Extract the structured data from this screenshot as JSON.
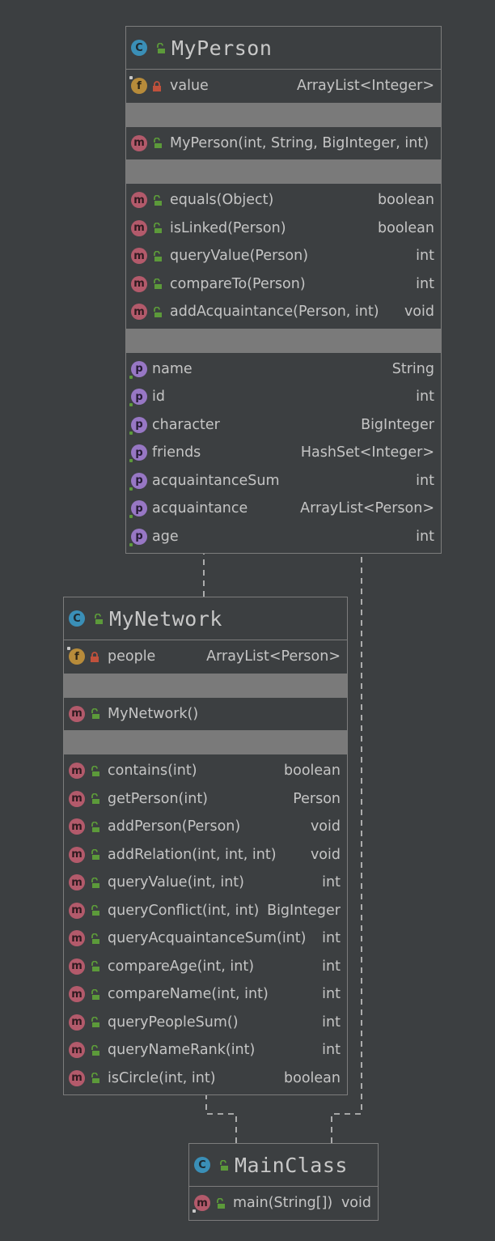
{
  "colors": {
    "background": "#3c3f41",
    "border": "#7c7c7c",
    "gap": "#7a7a7a",
    "text": "#c5c5c5",
    "class_icon": "#3a8fb7",
    "field_icon": "#b78b3a",
    "method_icon": "#b35a6b",
    "property_icon": "#9777c4",
    "public_lock": "#5c9a3a",
    "private_lock": "#c0513c"
  },
  "classes": {
    "myperson": {
      "name": "MyPerson",
      "fields": [
        {
          "icon": "field-icon",
          "letter": "f",
          "vis": "private",
          "name": "value",
          "type": "ArrayList<Integer>"
        }
      ],
      "constructors": [
        {
          "icon": "method-icon",
          "letter": "m",
          "vis": "public",
          "name": "MyPerson(int, String, BigInteger, int)",
          "type": ""
        }
      ],
      "methods": [
        {
          "letter": "m",
          "vis": "public",
          "name": "equals(Object)",
          "type": "boolean"
        },
        {
          "letter": "m",
          "vis": "public",
          "name": "isLinked(Person)",
          "type": "boolean"
        },
        {
          "letter": "m",
          "vis": "public",
          "name": "queryValue(Person)",
          "type": "int"
        },
        {
          "letter": "m",
          "vis": "public",
          "name": "compareTo(Person)",
          "type": "int"
        },
        {
          "letter": "m",
          "vis": "public",
          "name": "addAcquaintance(Person, int)",
          "type": "void"
        }
      ],
      "properties": [
        {
          "letter": "p",
          "name": "name",
          "type": "String"
        },
        {
          "letter": "p",
          "name": "id",
          "type": "int"
        },
        {
          "letter": "p",
          "name": "character",
          "type": "BigInteger"
        },
        {
          "letter": "p",
          "name": "friends",
          "type": "HashSet<Integer>"
        },
        {
          "letter": "p",
          "name": "acquaintanceSum",
          "type": "int"
        },
        {
          "letter": "p",
          "name": "acquaintance",
          "type": "ArrayList<Person>"
        },
        {
          "letter": "p",
          "name": "age",
          "type": "int"
        }
      ]
    },
    "mynetwork": {
      "name": "MyNetwork",
      "fields": [
        {
          "letter": "f",
          "vis": "private",
          "name": "people",
          "type": "ArrayList<Person>"
        }
      ],
      "constructors": [
        {
          "letter": "m",
          "vis": "public",
          "name": "MyNetwork()",
          "type": ""
        }
      ],
      "methods": [
        {
          "letter": "m",
          "vis": "public",
          "name": "contains(int)",
          "type": "boolean"
        },
        {
          "letter": "m",
          "vis": "public",
          "name": "getPerson(int)",
          "type": "Person"
        },
        {
          "letter": "m",
          "vis": "public",
          "name": "addPerson(Person)",
          "type": "void"
        },
        {
          "letter": "m",
          "vis": "public",
          "name": "addRelation(int, int, int)",
          "type": "void"
        },
        {
          "letter": "m",
          "vis": "public",
          "name": "queryValue(int, int)",
          "type": "int"
        },
        {
          "letter": "m",
          "vis": "public",
          "name": "queryConflict(int, int)",
          "type": "BigInteger"
        },
        {
          "letter": "m",
          "vis": "public",
          "name": "queryAcquaintanceSum(int)",
          "type": "int"
        },
        {
          "letter": "m",
          "vis": "public",
          "name": "compareAge(int, int)",
          "type": "int"
        },
        {
          "letter": "m",
          "vis": "public",
          "name": "compareName(int, int)",
          "type": "int"
        },
        {
          "letter": "m",
          "vis": "public",
          "name": "queryPeopleSum()",
          "type": "int"
        },
        {
          "letter": "m",
          "vis": "public",
          "name": "queryNameRank(int)",
          "type": "int"
        },
        {
          "letter": "m",
          "vis": "public",
          "name": "isCircle(int, int)",
          "type": "boolean"
        }
      ]
    },
    "mainclass": {
      "name": "MainClass",
      "methods": [
        {
          "letter": "m",
          "vis": "public",
          "name": "main(String[])",
          "type": "void"
        }
      ]
    }
  },
  "icon_letters": {
    "class": "C"
  }
}
